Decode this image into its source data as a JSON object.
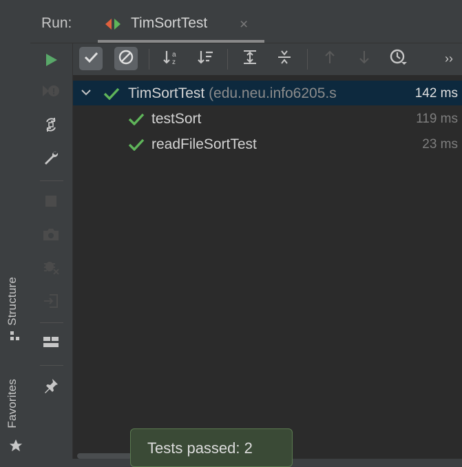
{
  "header": {
    "run_label": "Run:",
    "tab_title": "TimSortTest",
    "close_symbol": "×"
  },
  "side_tabs": {
    "structure": "Structure",
    "favorites": "Favorites"
  },
  "toolbar": {
    "more": "››"
  },
  "tree": {
    "root": {
      "name": "TimSortTest",
      "package": " (edu.neu.info6205.s",
      "time": "142 ms",
      "status": "passed"
    },
    "children": [
      {
        "name": "testSort",
        "time": "119 ms",
        "status": "passed"
      },
      {
        "name": "readFileSortTest",
        "time": "23 ms",
        "status": "passed"
      }
    ]
  },
  "toast": {
    "text": "Tests passed: 2"
  },
  "colors": {
    "pass_green": "#5fb55a",
    "run_green": "#59a869",
    "selection": "#0d293e",
    "tab_red": "#e0603d"
  },
  "icons": [
    "run-icon",
    "rerun-failed-icon",
    "toggle-auto-test-icon",
    "wrench-icon",
    "stop-icon",
    "camera-icon",
    "debug-off-icon",
    "import-icon",
    "layout-icon",
    "pin-icon",
    "show-passed-icon",
    "show-ignored-icon",
    "sort-alpha-icon",
    "sort-duration-icon",
    "expand-all-icon",
    "collapse-all-icon",
    "up-arrow-icon",
    "down-arrow-icon",
    "history-icon"
  ]
}
